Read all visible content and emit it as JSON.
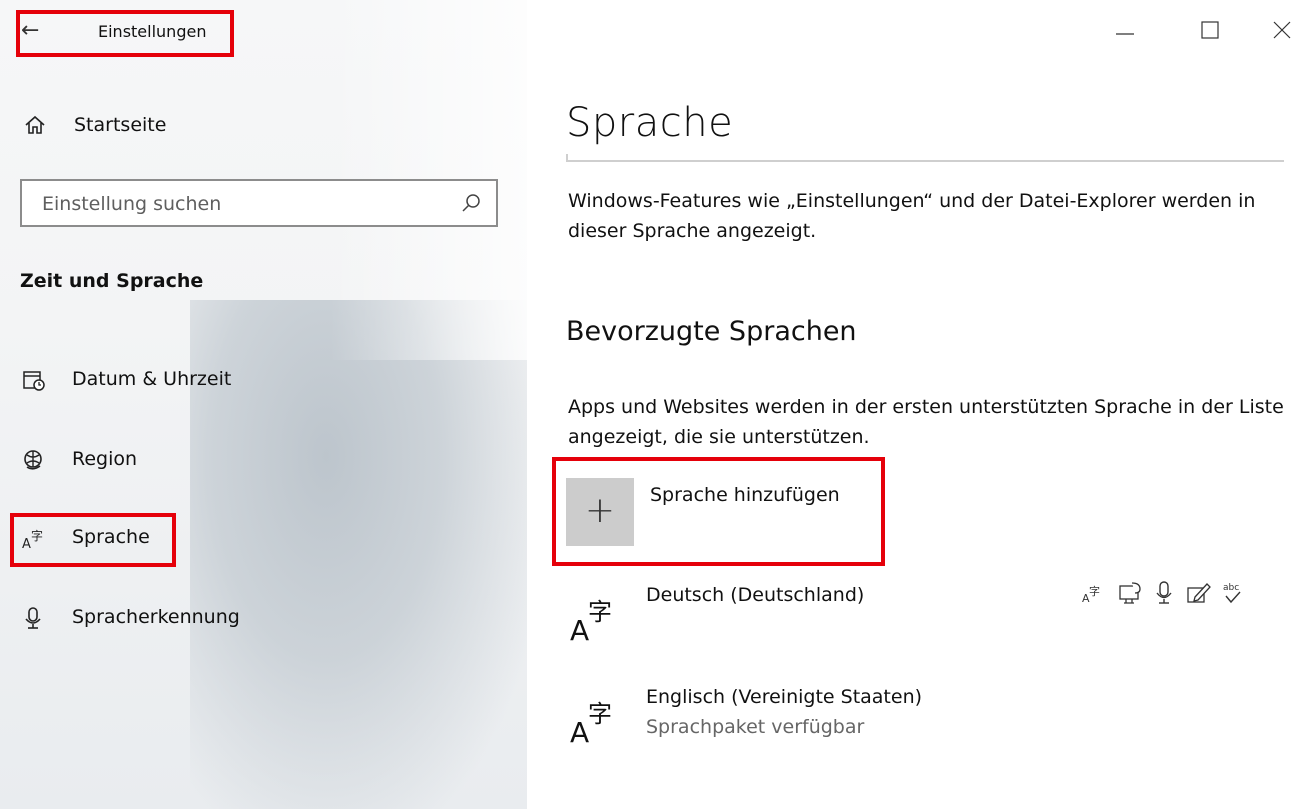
{
  "window": {
    "title": "Einstellungen",
    "controls": {
      "minimize": "—",
      "maximize": "☐",
      "close": "✕"
    }
  },
  "sidebar": {
    "home_label": "Startseite",
    "search": {
      "placeholder": "Einstellung suchen",
      "value": ""
    },
    "section_title": "Zeit und Sprache",
    "items": [
      {
        "label": "Datum & Uhrzeit",
        "icon": "calendar-clock-icon"
      },
      {
        "label": "Region",
        "icon": "globe-icon"
      },
      {
        "label": "Sprache",
        "icon": "language-icon",
        "selected": true
      },
      {
        "label": "Spracherkennung",
        "icon": "microphone-icon"
      }
    ]
  },
  "main": {
    "title": "Sprache",
    "description": "Windows-Features wie „Einstellungen“ und der Datei-Explorer werden in dieser Sprache angezeigt.",
    "preferred_heading": "Bevorzugte Sprachen",
    "preferred_description": "Apps und Websites werden in der ersten unterstützten Sprache in der Liste angezeigt, die sie unterstützen.",
    "add_language": {
      "icon": "+",
      "label": "Sprache hinzufügen"
    },
    "languages": [
      {
        "name": "Deutsch (Deutschland)",
        "status": "",
        "feature_icons": [
          "language-pack-icon",
          "text-to-speech-icon",
          "speech-recognition-icon",
          "handwriting-icon",
          "spellcheck-icon"
        ],
        "spellcheck_text": "abc"
      },
      {
        "name": "Englisch (Vereinigte Staaten)",
        "status": "Sprachpaket verfügbar"
      }
    ]
  },
  "annotations": {
    "highlight_color": "#e5000a"
  }
}
